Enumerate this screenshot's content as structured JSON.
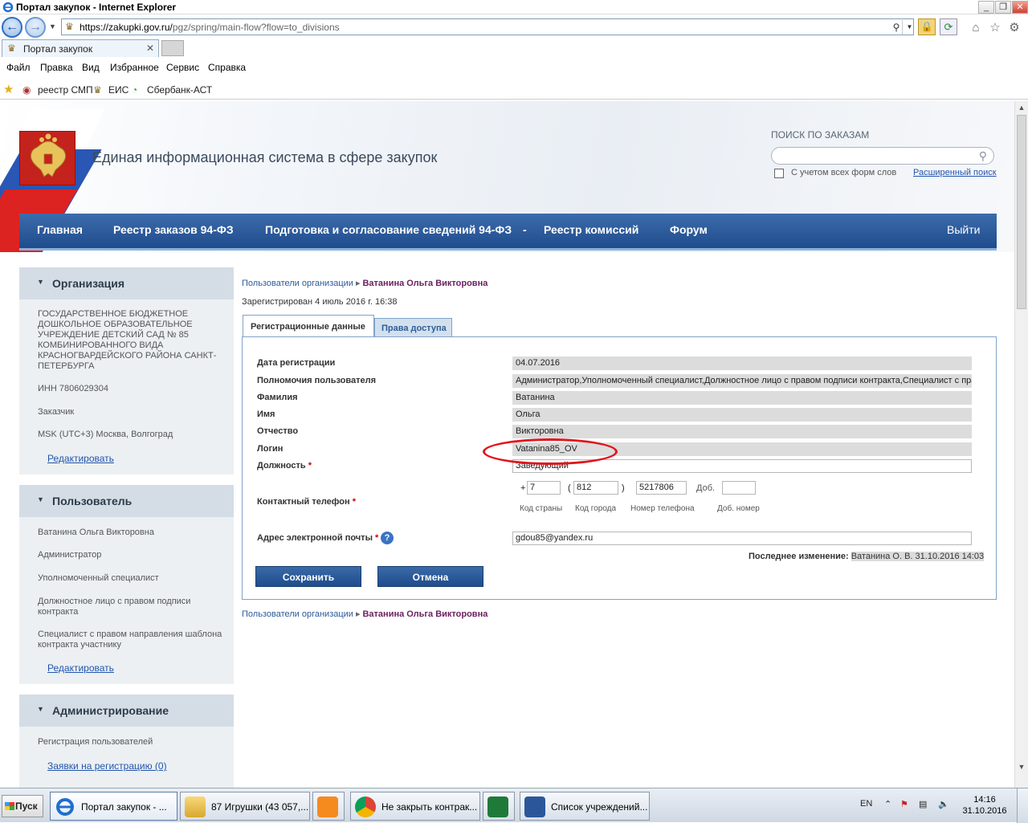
{
  "window": {
    "title": "Портал закупок - Internet Explorer"
  },
  "addressbar": {
    "url_prefix": "https://zakupki.gov.ru/",
    "url_suffix": "pgz/spring/main-flow?flow=to_divisions"
  },
  "browser_tab": {
    "label": "Портал закупок"
  },
  "menu": [
    "Файл",
    "Правка",
    "Вид",
    "Избранное",
    "Сервис",
    "Справка"
  ],
  "favorites": [
    "реестр СМП",
    "ЕИС",
    "Сбербанк-АСТ"
  ],
  "site": {
    "title": "Единая информационная система в сфере закупок",
    "search_label": "ПОИСК ПО ЗАКАЗАМ",
    "search_checkbox_label": "С учетом всех форм слов",
    "advanced_search": "Расширенный поиск"
  },
  "topnav": [
    "Главная",
    "Реестр заказов 94-ФЗ",
    "Подготовка и согласование сведений 94-ФЗ",
    "-",
    "Реестр комиссий",
    "Форум",
    "Выйти"
  ],
  "sidebar": {
    "organization": {
      "title": "Организация",
      "name": "ГОСУДАРСТВЕННОЕ БЮДЖЕТНОЕ ДОШКОЛЬНОЕ ОБРАЗОВАТЕЛЬНОЕ УЧРЕЖДЕНИЕ ДЕТСКИЙ САД № 85 КОМБИНИРОВАННОГО ВИДА КРАСНОГВАРДЕЙСКОГО РАЙОНА САНКТ-ПЕТЕРБУРГА",
      "inn": "ИНН 7806029304",
      "role": "Заказчик",
      "timezone": "MSK (UTC+3) Москва, Волгоград",
      "edit": "Редактировать"
    },
    "user": {
      "title": "Пользователь",
      "items": [
        "Ватанина Ольга Викторовна",
        "Администратор",
        "Уполномоченный специалист",
        "Должностное лицо с правом подписи контракта",
        "Специалист с правом направления шаблона контракта участнику"
      ],
      "edit": "Редактировать"
    },
    "admin": {
      "title": "Администрирование",
      "item": "Регистрация пользователей",
      "link": "Заявки на регистрацию (0)"
    }
  },
  "breadcrumb": {
    "parent": "Пользователи организации",
    "current": "Ватанина Ольга Викторовна"
  },
  "registered": "Зарегистрирован 4 июль 2016 г. 16:38",
  "tabs": {
    "active": "Регистрационные данные",
    "inactive": "Права доступа"
  },
  "form": {
    "reg_date_label": "Дата регистрации",
    "reg_date": "04.07.2016",
    "authority_label": "Полномочия пользователя",
    "authority": "Администратор,Уполномоченный специалист,Должностное лицо с правом подписи контракта,Специалист с пра",
    "surname_label": "Фамилия",
    "surname": "Ватанина",
    "name_label": "Имя",
    "name": "Ольга",
    "patronymic_label": "Отчество",
    "patronymic": "Викторовна",
    "login_label": "Логин",
    "login": "Vatanina85_OV",
    "position_label": "Должность",
    "position": "Заведующий",
    "phone_label": "Контактный телефон",
    "phone": {
      "plus": "+",
      "country": "7",
      "open_paren": "(",
      "city": "812",
      "close_paren": ")",
      "number": "5217806",
      "ext_label": "Доб.",
      "ext": ""
    },
    "phone_sublabels": [
      "Код страны",
      "Код города",
      "Номер телефона",
      "Доб. номер"
    ],
    "email_label": "Адрес электронной почты",
    "email": "gdou85@yandex.ru",
    "required_mark": "*",
    "help": "?",
    "last_change_label": "Последнее изменение:",
    "last_change": "Ватанина О. В. 31.10.2016 14:03",
    "save": "Сохранить",
    "cancel": "Отмена"
  },
  "taskbar": {
    "start": "Пуск",
    "tasks": [
      "Портал закупок - ...",
      "87 Игрушки (43 057,...",
      "",
      "Не закрыть контрак...",
      "",
      "Список учреждений..."
    ],
    "lang": "EN",
    "time": "14:16",
    "date": "31.10.2016"
  },
  "colors": {
    "nav": "#2a5a9c",
    "accent_link": "#2255aa",
    "annotation": "#e0141c"
  }
}
